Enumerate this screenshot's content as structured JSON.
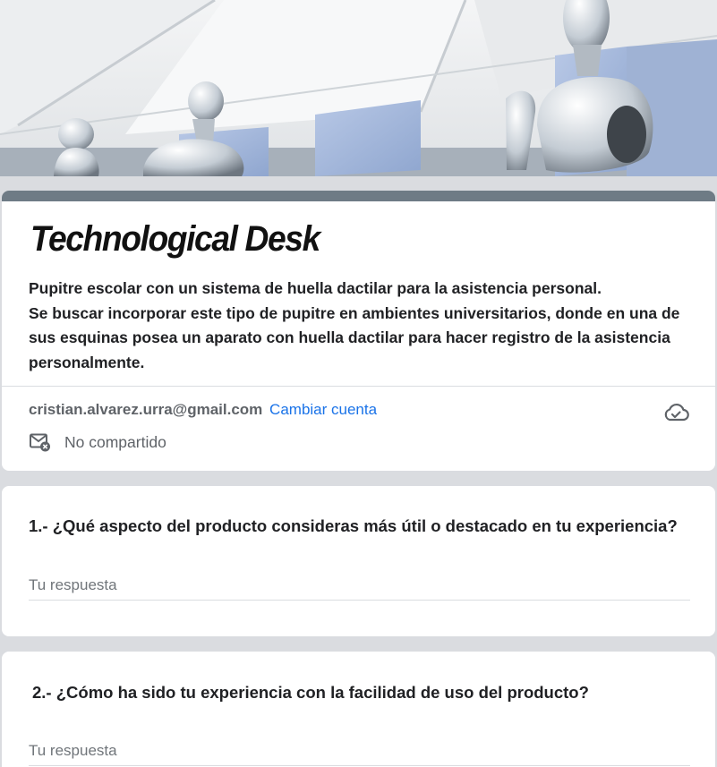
{
  "header": {
    "image_description": "robots-at-desks-banner"
  },
  "form": {
    "title": "Technological Desk",
    "description_lines": [
      "Pupitre escolar con un sistema de huella dactilar para la asistencia personal.",
      "Se buscar incorporar este tipo de pupitre en ambientes universitarios, donde en una de",
      "sus esquinas posea un aparato con huella dactilar para hacer registro de la asistencia",
      "personalmente."
    ],
    "accent_color": "#6e7b85"
  },
  "account": {
    "email": "cristian.alvarez.urra@gmail.com",
    "switch_label": "Cambiar cuenta",
    "share_status": "No compartido",
    "link_color": "#1a73e8",
    "cloud_icon": "cloud-check-icon",
    "mail_icon": "mail-not-shared-icon"
  },
  "questions": [
    {
      "title": "1.- ¿Qué aspecto del producto consideras más útil o destacado en tu experiencia?",
      "placeholder": "Tu respuesta",
      "value": ""
    },
    {
      "title": "2.- ¿Cómo ha sido tu experiencia con la facilidad de uso del producto?",
      "placeholder": "Tu respuesta",
      "value": ""
    }
  ]
}
